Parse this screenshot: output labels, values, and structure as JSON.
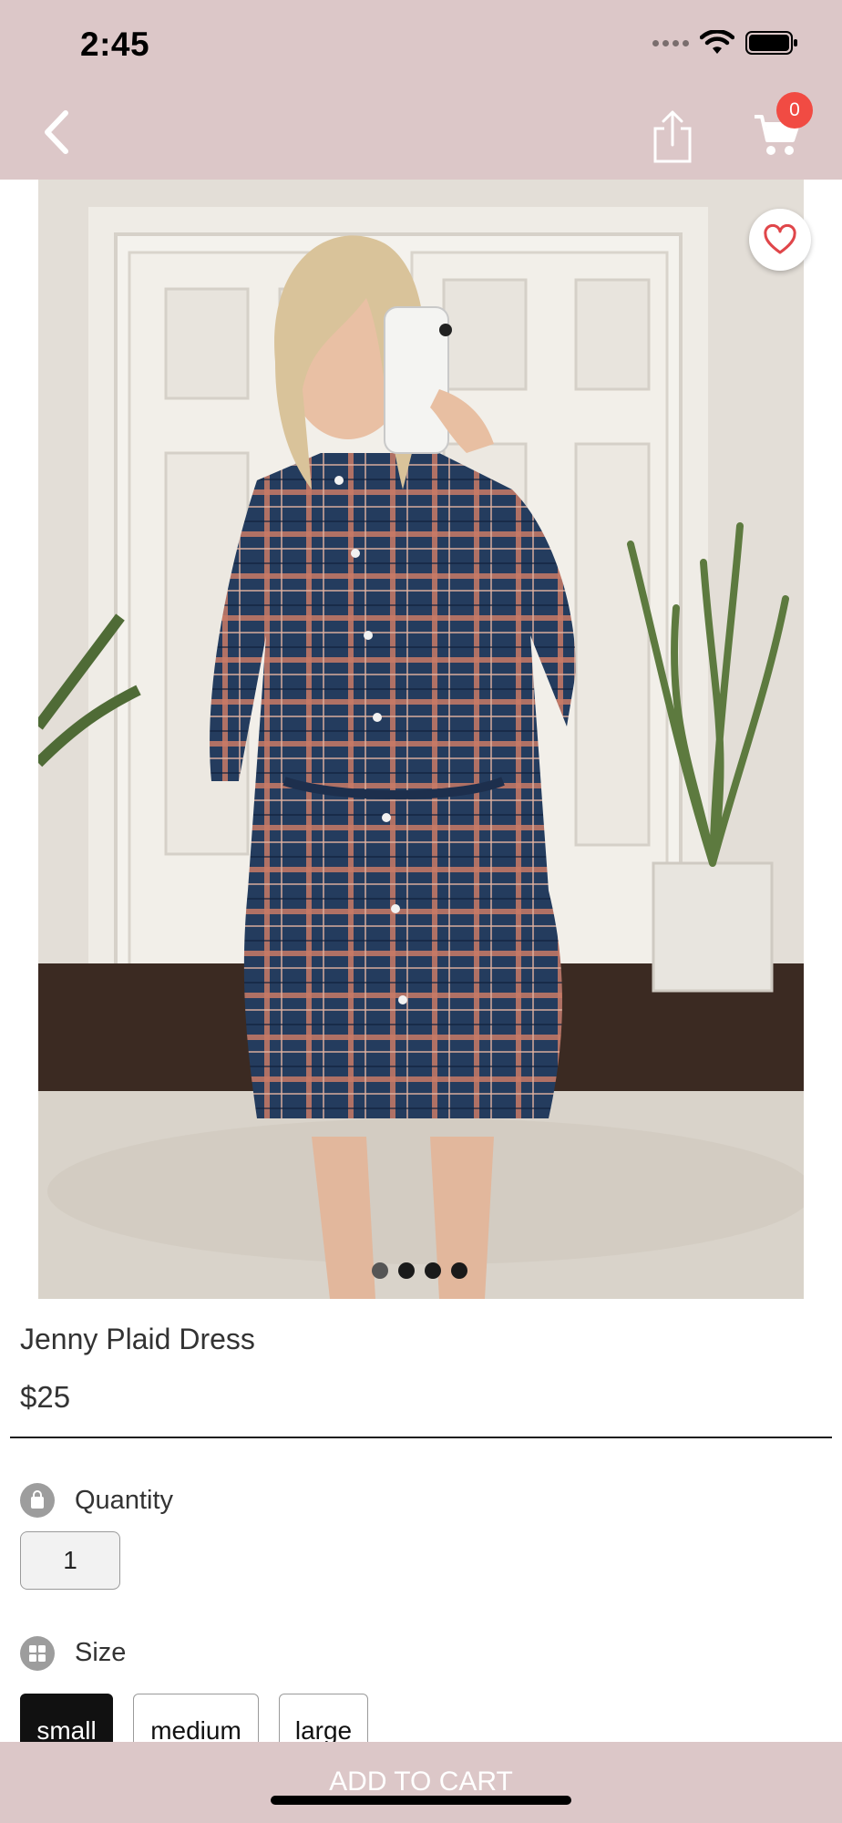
{
  "status_bar": {
    "time": "2:45"
  },
  "header": {
    "cart_count": "0",
    "icons": [
      "back-chevron-icon",
      "share-icon",
      "cart-icon"
    ]
  },
  "product": {
    "name": "Jenny Plaid Dress",
    "price": "$25",
    "image_count": 4,
    "active_image_index": 0
  },
  "quantity": {
    "label": "Quantity",
    "value": "1"
  },
  "size": {
    "label": "Size",
    "options": [
      "small",
      "medium",
      "large"
    ],
    "selected": "small"
  },
  "footer": {
    "add_to_cart_label": "ADD TO CART"
  },
  "colors": {
    "header_bg": "#dcc7c8",
    "badge": "#f14b43",
    "heart": "#e0464a"
  }
}
